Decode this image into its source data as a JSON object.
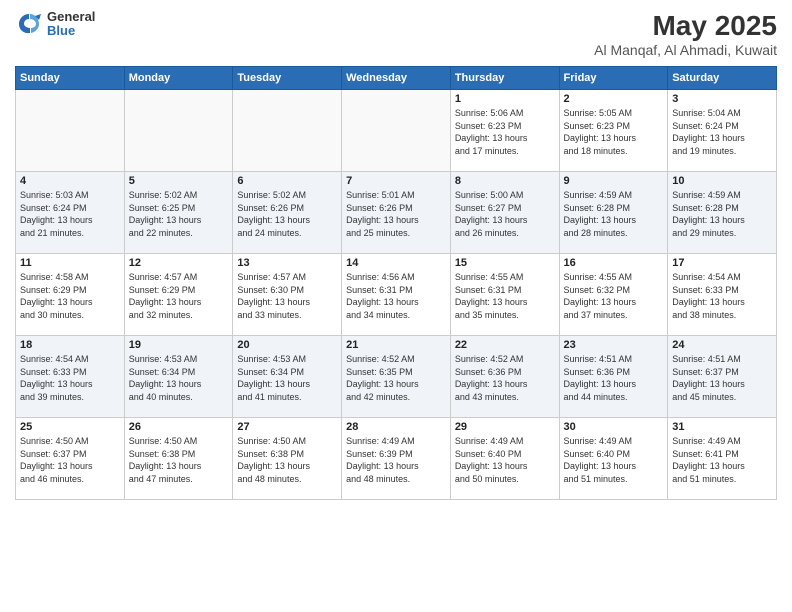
{
  "logo": {
    "general": "General",
    "blue": "Blue"
  },
  "title": "May 2025",
  "location": "Al Manqaf, Al Ahmadi, Kuwait",
  "days_of_week": [
    "Sunday",
    "Monday",
    "Tuesday",
    "Wednesday",
    "Thursday",
    "Friday",
    "Saturday"
  ],
  "weeks": [
    [
      {
        "day": "",
        "info": ""
      },
      {
        "day": "",
        "info": ""
      },
      {
        "day": "",
        "info": ""
      },
      {
        "day": "",
        "info": ""
      },
      {
        "day": "1",
        "info": "Sunrise: 5:06 AM\nSunset: 6:23 PM\nDaylight: 13 hours\nand 17 minutes."
      },
      {
        "day": "2",
        "info": "Sunrise: 5:05 AM\nSunset: 6:23 PM\nDaylight: 13 hours\nand 18 minutes."
      },
      {
        "day": "3",
        "info": "Sunrise: 5:04 AM\nSunset: 6:24 PM\nDaylight: 13 hours\nand 19 minutes."
      }
    ],
    [
      {
        "day": "4",
        "info": "Sunrise: 5:03 AM\nSunset: 6:24 PM\nDaylight: 13 hours\nand 21 minutes."
      },
      {
        "day": "5",
        "info": "Sunrise: 5:02 AM\nSunset: 6:25 PM\nDaylight: 13 hours\nand 22 minutes."
      },
      {
        "day": "6",
        "info": "Sunrise: 5:02 AM\nSunset: 6:26 PM\nDaylight: 13 hours\nand 24 minutes."
      },
      {
        "day": "7",
        "info": "Sunrise: 5:01 AM\nSunset: 6:26 PM\nDaylight: 13 hours\nand 25 minutes."
      },
      {
        "day": "8",
        "info": "Sunrise: 5:00 AM\nSunset: 6:27 PM\nDaylight: 13 hours\nand 26 minutes."
      },
      {
        "day": "9",
        "info": "Sunrise: 4:59 AM\nSunset: 6:28 PM\nDaylight: 13 hours\nand 28 minutes."
      },
      {
        "day": "10",
        "info": "Sunrise: 4:59 AM\nSunset: 6:28 PM\nDaylight: 13 hours\nand 29 minutes."
      }
    ],
    [
      {
        "day": "11",
        "info": "Sunrise: 4:58 AM\nSunset: 6:29 PM\nDaylight: 13 hours\nand 30 minutes."
      },
      {
        "day": "12",
        "info": "Sunrise: 4:57 AM\nSunset: 6:29 PM\nDaylight: 13 hours\nand 32 minutes."
      },
      {
        "day": "13",
        "info": "Sunrise: 4:57 AM\nSunset: 6:30 PM\nDaylight: 13 hours\nand 33 minutes."
      },
      {
        "day": "14",
        "info": "Sunrise: 4:56 AM\nSunset: 6:31 PM\nDaylight: 13 hours\nand 34 minutes."
      },
      {
        "day": "15",
        "info": "Sunrise: 4:55 AM\nSunset: 6:31 PM\nDaylight: 13 hours\nand 35 minutes."
      },
      {
        "day": "16",
        "info": "Sunrise: 4:55 AM\nSunset: 6:32 PM\nDaylight: 13 hours\nand 37 minutes."
      },
      {
        "day": "17",
        "info": "Sunrise: 4:54 AM\nSunset: 6:33 PM\nDaylight: 13 hours\nand 38 minutes."
      }
    ],
    [
      {
        "day": "18",
        "info": "Sunrise: 4:54 AM\nSunset: 6:33 PM\nDaylight: 13 hours\nand 39 minutes."
      },
      {
        "day": "19",
        "info": "Sunrise: 4:53 AM\nSunset: 6:34 PM\nDaylight: 13 hours\nand 40 minutes."
      },
      {
        "day": "20",
        "info": "Sunrise: 4:53 AM\nSunset: 6:34 PM\nDaylight: 13 hours\nand 41 minutes."
      },
      {
        "day": "21",
        "info": "Sunrise: 4:52 AM\nSunset: 6:35 PM\nDaylight: 13 hours\nand 42 minutes."
      },
      {
        "day": "22",
        "info": "Sunrise: 4:52 AM\nSunset: 6:36 PM\nDaylight: 13 hours\nand 43 minutes."
      },
      {
        "day": "23",
        "info": "Sunrise: 4:51 AM\nSunset: 6:36 PM\nDaylight: 13 hours\nand 44 minutes."
      },
      {
        "day": "24",
        "info": "Sunrise: 4:51 AM\nSunset: 6:37 PM\nDaylight: 13 hours\nand 45 minutes."
      }
    ],
    [
      {
        "day": "25",
        "info": "Sunrise: 4:50 AM\nSunset: 6:37 PM\nDaylight: 13 hours\nand 46 minutes."
      },
      {
        "day": "26",
        "info": "Sunrise: 4:50 AM\nSunset: 6:38 PM\nDaylight: 13 hours\nand 47 minutes."
      },
      {
        "day": "27",
        "info": "Sunrise: 4:50 AM\nSunset: 6:38 PM\nDaylight: 13 hours\nand 48 minutes."
      },
      {
        "day": "28",
        "info": "Sunrise: 4:49 AM\nSunset: 6:39 PM\nDaylight: 13 hours\nand 48 minutes."
      },
      {
        "day": "29",
        "info": "Sunrise: 4:49 AM\nSunset: 6:40 PM\nDaylight: 13 hours\nand 50 minutes."
      },
      {
        "day": "30",
        "info": "Sunrise: 4:49 AM\nSunset: 6:40 PM\nDaylight: 13 hours\nand 51 minutes."
      },
      {
        "day": "31",
        "info": "Sunrise: 4:49 AM\nSunset: 6:41 PM\nDaylight: 13 hours\nand 51 minutes."
      }
    ]
  ]
}
